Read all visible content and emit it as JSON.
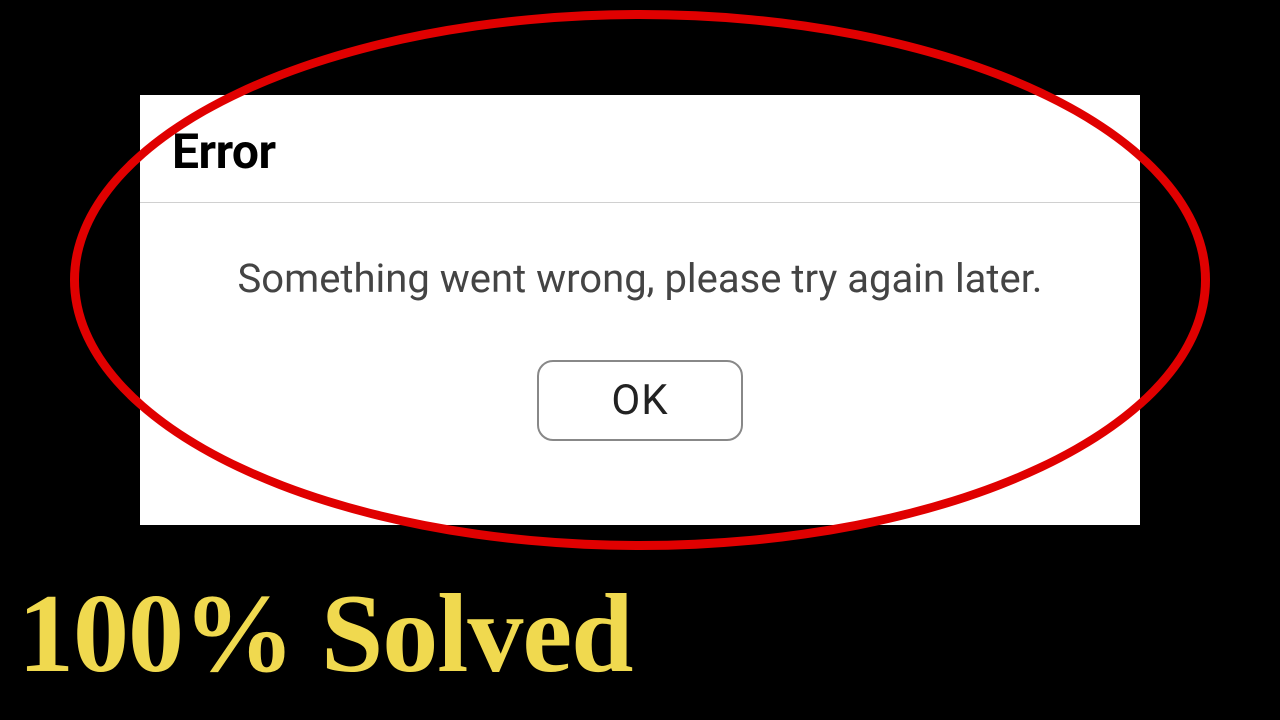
{
  "dialog": {
    "title": "Error",
    "message": "Something went wrong, please try again later.",
    "ok_label": "OK"
  },
  "caption": "100% Solved"
}
